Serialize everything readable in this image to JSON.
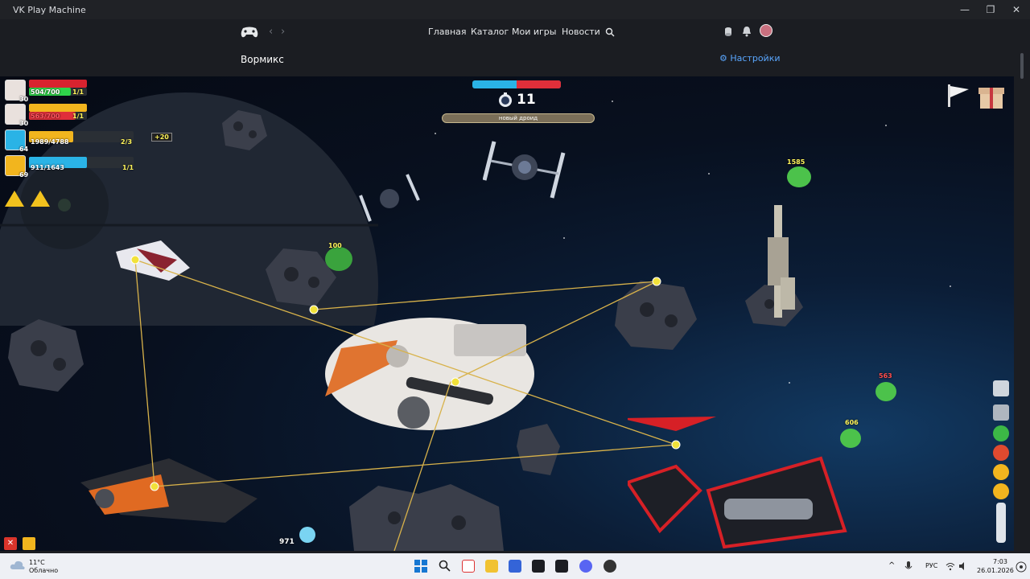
{
  "window": {
    "title": "VK Play Machine",
    "minimize": "—",
    "maximize": "❐",
    "close": "✕"
  },
  "nav": {
    "back": "‹",
    "forward": "›",
    "items": [
      "Главная",
      "Каталог",
      "Мои игры",
      "Новости"
    ]
  },
  "page": {
    "game_title": "Вормикс",
    "settings_label": "Настройки"
  },
  "hud": {
    "players": [
      {
        "level": "30",
        "hp": "504/700",
        "count": "1/1",
        "color": "#2fd44a"
      },
      {
        "level": "30",
        "hp": "563/700",
        "count": "1/1",
        "color": "#e02f3a"
      },
      {
        "level": "64",
        "hp": "1989/4788",
        "count": "2/3",
        "color": "#f2b51e"
      },
      {
        "level": "69",
        "hp": "911/1643",
        "count": "1/1",
        "color": "#2ab3e6"
      }
    ],
    "bonus": "+20",
    "timer": "11",
    "turn_label": "новый дроид",
    "bottom_value": "971"
  },
  "world": {
    "labels": {
      "e1": "100",
      "e2": "1585",
      "e3": "606",
      "e4": "563"
    }
  },
  "taskbar": {
    "weather_temp": "11°C",
    "weather_desc": "Облачно",
    "lang": "РУС",
    "time": "7:03",
    "date": "26.01.2026"
  },
  "colors": {
    "accent_blue": "#5aa7ff",
    "rope": "#d8b24a"
  }
}
